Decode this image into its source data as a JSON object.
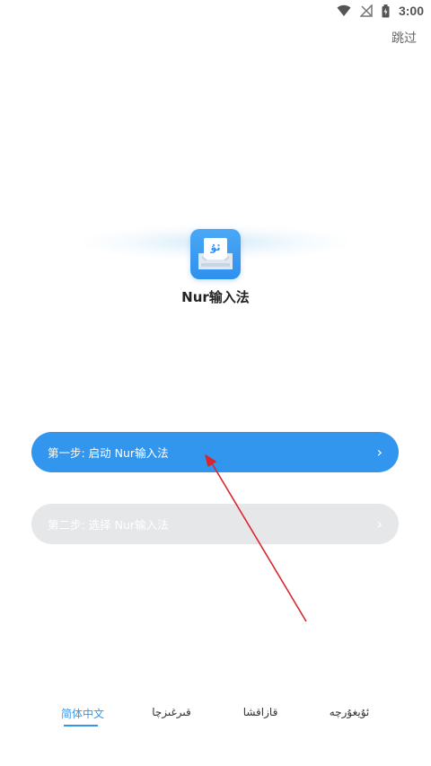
{
  "status_bar": {
    "time": "3:00",
    "icons": [
      "wifi-icon",
      "no-signal-icon",
      "battery-icon"
    ]
  },
  "header": {
    "skip_label": "跳过"
  },
  "app": {
    "name": "Nur输入法",
    "logo_glyph": "ئۇ",
    "logo_icon": "keyboard-icon"
  },
  "steps": [
    {
      "label": "第一步: 启动 Nur输入法",
      "enabled": true,
      "chevron": "›"
    },
    {
      "label": "第二步: 选择 Nur输入法",
      "enabled": false,
      "chevron": "›"
    }
  ],
  "language_tabs": [
    {
      "label": "简体中文",
      "active": true
    },
    {
      "label": "قىرغىزچا",
      "active": false
    },
    {
      "label": "قازاقشا",
      "active": false
    },
    {
      "label": "ئۇيغۇرچە",
      "active": false
    }
  ],
  "colors": {
    "primary": "#3396ee",
    "disabled": "#e6e7e9",
    "annotation": "#d9262c"
  }
}
